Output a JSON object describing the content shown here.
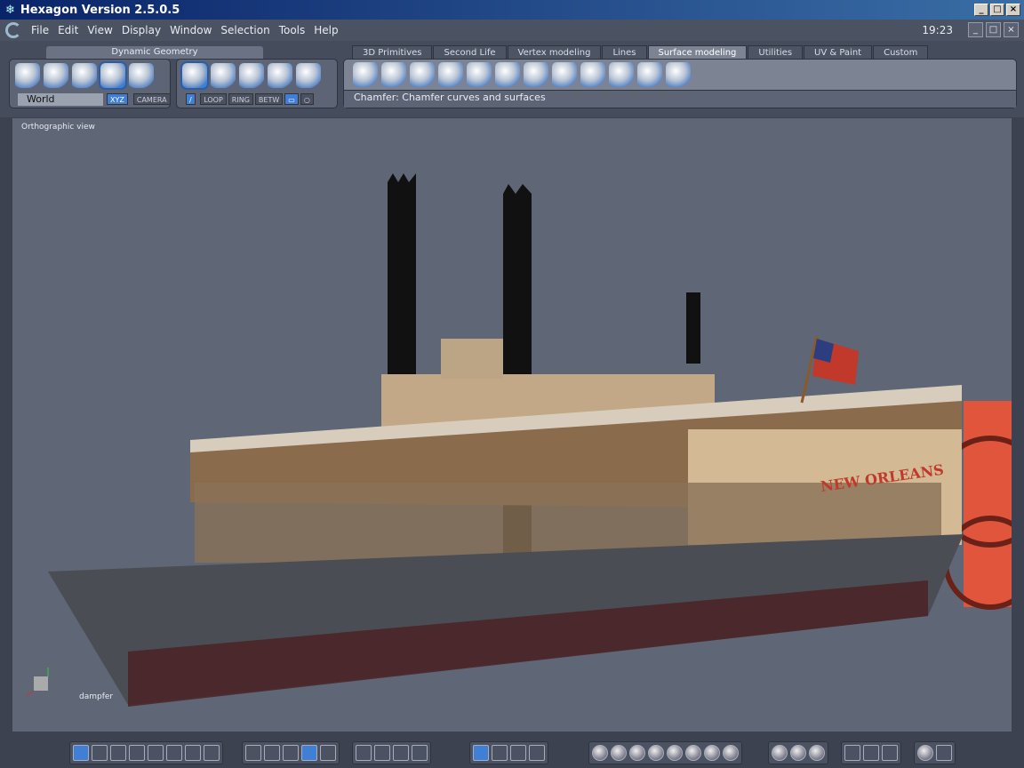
{
  "window": {
    "title": "Hexagon Version 2.5.0.5",
    "clock": "19:23"
  },
  "menu": [
    "File",
    "Edit",
    "View",
    "Display",
    "Window",
    "Selection",
    "Tools",
    "Help"
  ],
  "dynamic_geometry": {
    "title": "Dynamic Geometry",
    "coord_space": "World",
    "xyz": "XYZ",
    "camera": "CAMERA"
  },
  "selection_buttons": [
    "LOOP",
    "RING",
    "BETW"
  ],
  "tabs": [
    {
      "label": "3D Primitives"
    },
    {
      "label": "Second Life"
    },
    {
      "label": "Vertex modeling"
    },
    {
      "label": "Lines"
    },
    {
      "label": "Surface modeling",
      "active": true
    },
    {
      "label": "Utilities"
    },
    {
      "label": "UV & Paint"
    },
    {
      "label": "Custom"
    }
  ],
  "status_text": "Chamfer: Chamfer curves and surfaces",
  "viewport": {
    "label": "Orthographic view",
    "object_name": "dampfer",
    "ship_name": "NEW ORLEANS"
  },
  "colors": {
    "accent": "#3f7fd6",
    "viewport_bg": "#5f6676",
    "title_bar": "#0a246a"
  }
}
